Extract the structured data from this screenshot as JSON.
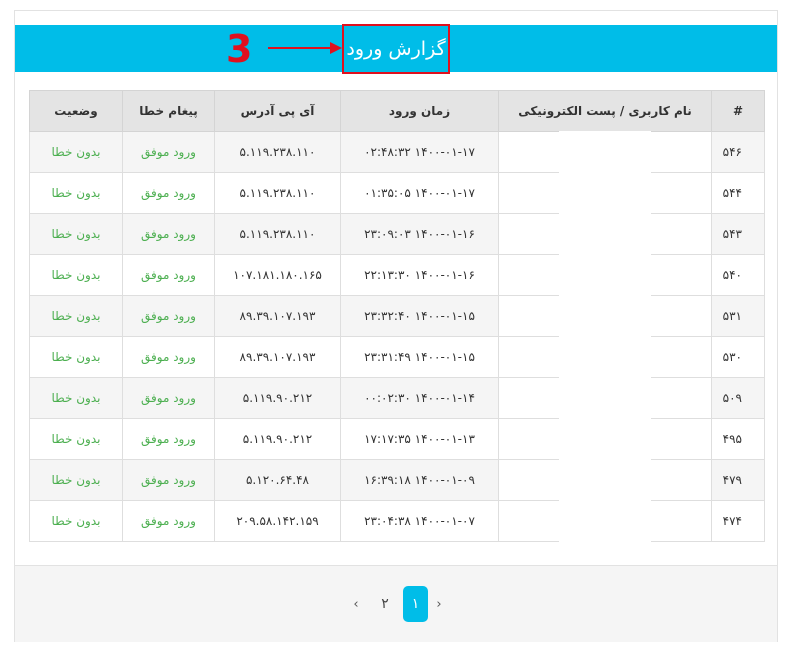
{
  "header": {
    "title": "گزارش ورود"
  },
  "annotation": {
    "step_number": "3",
    "color": "#e0101e"
  },
  "colors": {
    "accent": "#00bde8",
    "success_text": "#4caf50",
    "header_bg": "#e4e4e4"
  },
  "table": {
    "columns": [
      "#",
      "نام کاربری / پست الکترونیکی",
      "زمان ورود",
      "آی پی آدرس",
      "پیغام خطا",
      "وضعیت"
    ],
    "rows": [
      {
        "id": "۵۴۶",
        "user": "",
        "time": "۱۴۰۰-۰۱-۱۷ ۰۲:۴۸:۳۲",
        "ip": "۵.۱۱۹.۲۳۸.۱۱۰",
        "message": "ورود موفق",
        "status": "بدون خطا"
      },
      {
        "id": "۵۴۴",
        "user": "",
        "time": "۱۴۰۰-۰۱-۱۷ ۰۱:۳۵:۰۵",
        "ip": "۵.۱۱۹.۲۳۸.۱۱۰",
        "message": "ورود موفق",
        "status": "بدون خطا"
      },
      {
        "id": "۵۴۳",
        "user": "",
        "time": "۱۴۰۰-۰۱-۱۶ ۲۳:۰۹:۰۳",
        "ip": "۵.۱۱۹.۲۳۸.۱۱۰",
        "message": "ورود موفق",
        "status": "بدون خطا"
      },
      {
        "id": "۵۴۰",
        "user": "",
        "time": "۱۴۰۰-۰۱-۱۶ ۲۲:۱۳:۳۰",
        "ip": "۱۰۷.۱۸۱.۱۸۰.۱۶۵",
        "message": "ورود موفق",
        "status": "بدون خطا"
      },
      {
        "id": "۵۳۱",
        "user": "",
        "time": "۱۴۰۰-۰۱-۱۵ ۲۳:۳۲:۴۰",
        "ip": "۸۹.۳۹.۱۰۷.۱۹۳",
        "message": "ورود موفق",
        "status": "بدون خطا"
      },
      {
        "id": "۵۳۰",
        "user": "",
        "time": "۱۴۰۰-۰۱-۱۵ ۲۳:۳۱:۴۹",
        "ip": "۸۹.۳۹.۱۰۷.۱۹۳",
        "message": "ورود موفق",
        "status": "بدون خطا"
      },
      {
        "id": "۵۰۹",
        "user": "",
        "time": "۱۴۰۰-۰۱-۱۴ ۰۰:۰۲:۳۰",
        "ip": "۵.۱۱۹.۹۰.۲۱۲",
        "message": "ورود موفق",
        "status": "بدون خطا"
      },
      {
        "id": "۴۹۵",
        "user": "",
        "time": "۱۴۰۰-۰۱-۱۳ ۱۷:۱۷:۳۵",
        "ip": "۵.۱۱۹.۹۰.۲۱۲",
        "message": "ورود موفق",
        "status": "بدون خطا"
      },
      {
        "id": "۴۷۹",
        "user": "",
        "time": "۱۴۰۰-۰۱-۰۹ ۱۶:۳۹:۱۸",
        "ip": "۵.۱۲۰.۶۴.۴۸",
        "message": "ورود موفق",
        "status": "بدون خطا"
      },
      {
        "id": "۴۷۴",
        "user": "",
        "time": "۱۴۰۰-۰۱-۰۷ ۲۳:۰۴:۳۸",
        "ip": "۲۰۹.۵۸.۱۴۲.۱۵۹",
        "message": "ورود موفق",
        "status": "بدون خطا"
      }
    ]
  },
  "pagination": {
    "prev": "‹",
    "pages": [
      "۲",
      "۱"
    ],
    "current": "۱",
    "next": "›"
  }
}
